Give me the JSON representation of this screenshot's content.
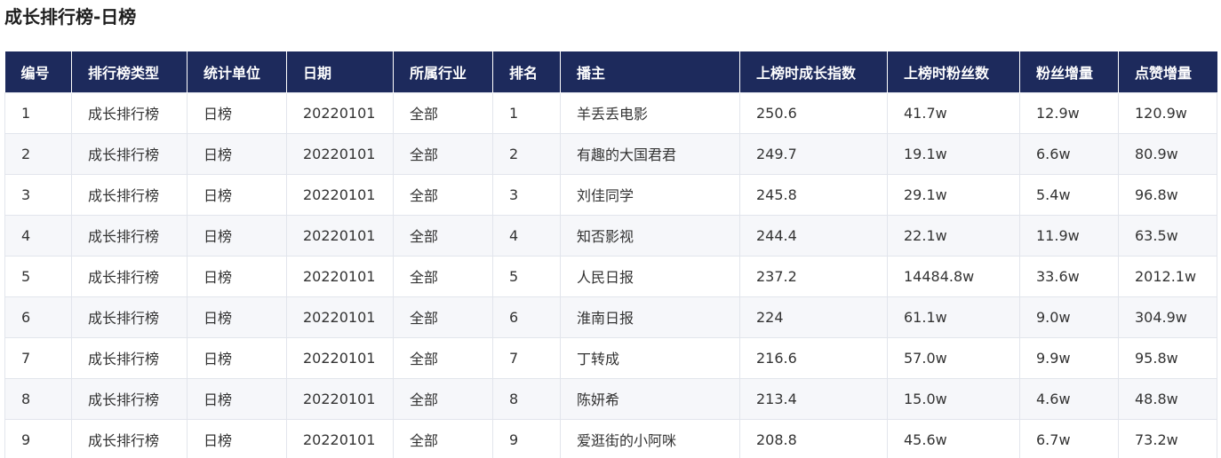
{
  "page": {
    "title": "成长排行榜-日榜"
  },
  "table": {
    "headers": [
      "编号",
      "排行榜类型",
      "统计单位",
      "日期",
      "所属行业",
      "排名",
      "播主",
      "上榜时成长指数",
      "上榜时粉丝数",
      "粉丝增量",
      "点赞增量"
    ],
    "rows": [
      [
        "1",
        "成长排行榜",
        "日榜",
        "20220101",
        "全部",
        "1",
        "羊丢丢电影",
        "250.6",
        "41.7w",
        "12.9w",
        "120.9w"
      ],
      [
        "2",
        "成长排行榜",
        "日榜",
        "20220101",
        "全部",
        "2",
        "有趣的大国君君",
        "249.7",
        "19.1w",
        "6.6w",
        "80.9w"
      ],
      [
        "3",
        "成长排行榜",
        "日榜",
        "20220101",
        "全部",
        "3",
        "刘佳同学",
        "245.8",
        "29.1w",
        "5.4w",
        "96.8w"
      ],
      [
        "4",
        "成长排行榜",
        "日榜",
        "20220101",
        "全部",
        "4",
        "知否影视",
        "244.4",
        "22.1w",
        "11.9w",
        "63.5w"
      ],
      [
        "5",
        "成长排行榜",
        "日榜",
        "20220101",
        "全部",
        "5",
        "人民日报",
        "237.2",
        "14484.8w",
        "33.6w",
        "2012.1w"
      ],
      [
        "6",
        "成长排行榜",
        "日榜",
        "20220101",
        "全部",
        "6",
        "淮南日报",
        "224",
        "61.1w",
        "9.0w",
        "304.9w"
      ],
      [
        "7",
        "成长排行榜",
        "日榜",
        "20220101",
        "全部",
        "7",
        "丁转成",
        "216.6",
        "57.0w",
        "9.9w",
        "95.8w"
      ],
      [
        "8",
        "成长排行榜",
        "日榜",
        "20220101",
        "全部",
        "8",
        "陈妍希",
        "213.4",
        "15.0w",
        "4.6w",
        "48.8w"
      ],
      [
        "9",
        "成长排行榜",
        "日榜",
        "20220101",
        "全部",
        "9",
        "爱逛街的小阿咪",
        "208.8",
        "45.6w",
        "6.7w",
        "73.2w"
      ]
    ]
  },
  "colors": {
    "header_bg": "#1d2a5c",
    "header_text": "#ffffff",
    "row_alt_bg": "#f6f7fa",
    "border": "#e2e5ec"
  }
}
